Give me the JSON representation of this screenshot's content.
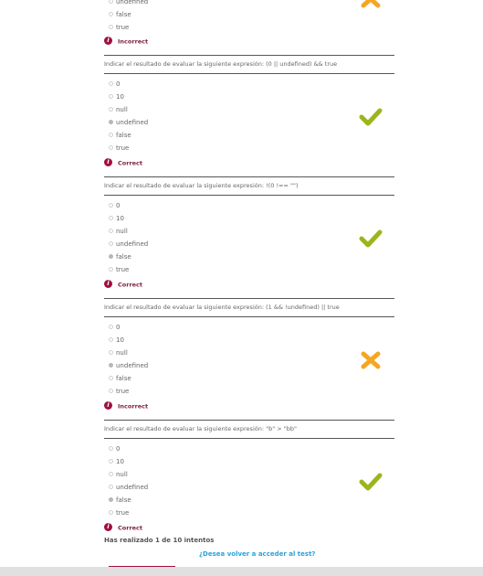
{
  "block0": {
    "options": [
      "undefined",
      "false",
      "true"
    ],
    "result_label": "Incorrect"
  },
  "block1": {
    "question": "Indicar el resultado de evaluar la siguiente expresión: (0 || undefined) && true",
    "options": [
      "0",
      "10",
      "null",
      "undefined",
      "false",
      "true"
    ],
    "selected": "undefined",
    "result_label": "Correct"
  },
  "block2": {
    "question": "Indicar el resultado de evaluar la siguiente expresión: !(0 !== \"\")",
    "options": [
      "0",
      "10",
      "null",
      "undefined",
      "false",
      "true"
    ],
    "selected": "false",
    "result_label": "Correct"
  },
  "block3": {
    "question": "Indicar el resultado de evaluar la siguiente expresión: (1 && !undefined) || true",
    "options": [
      "0",
      "10",
      "null",
      "undefined",
      "false",
      "true"
    ],
    "selected": "undefined",
    "result_label": "Incorrect"
  },
  "block4": {
    "question": "Indicar el resultado de evaluar la siguiente expresión: \"b\" > \"bb\"",
    "options": [
      "0",
      "10",
      "null",
      "undefined",
      "false",
      "true"
    ],
    "selected": "false",
    "result_label": "Correct"
  },
  "attempts_text": "Has realizado 1 de 10 intentos",
  "retry_link": "¿Desea volver a acceder al test?",
  "colors": {
    "correct_mark": "#9cb51c",
    "incorrect_mark": "#f5a623",
    "info_icon": "#a0103e",
    "link": "#2aa3d8"
  },
  "icons": {
    "correct": "check-icon",
    "incorrect": "cross-icon",
    "info": "info-icon"
  }
}
